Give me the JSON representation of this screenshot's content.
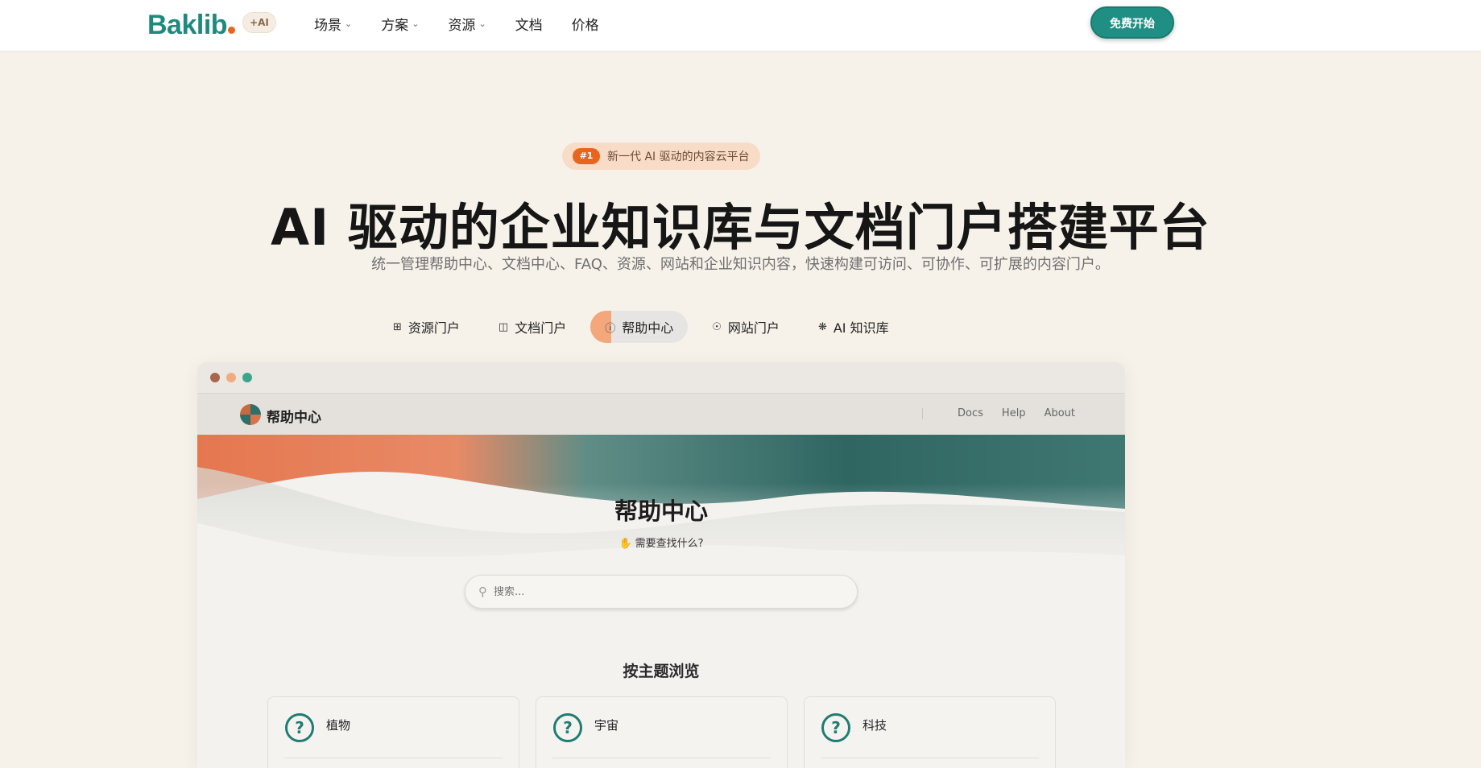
{
  "brand": {
    "name": "Baklib",
    "ai_badge": "+AI",
    "accent": "#1f8f84",
    "orange": "#e9651e"
  },
  "nav": {
    "items": [
      {
        "label": "场景",
        "dropdown": true
      },
      {
        "label": "方案",
        "dropdown": true
      },
      {
        "label": "资源",
        "dropdown": true
      },
      {
        "label": "文档",
        "dropdown": false
      },
      {
        "label": "价格",
        "dropdown": false
      }
    ],
    "cta": "免费开始"
  },
  "hero": {
    "announce_tag": "#1",
    "announce_text": "新一代 AI 驱动的内容云平台",
    "title": "AI 驱动的企业知识库与文档门户搭建平台",
    "subtitle": "统一管理帮助中心、文档中心、FAQ、资源、网站和企业知识内容，快速构建可访问、可协作、可扩展的内容门户。"
  },
  "tabs": [
    {
      "label": "资源门户",
      "icon": "resource-icon",
      "active": false
    },
    {
      "label": "文档门户",
      "icon": "document-icon",
      "active": false
    },
    {
      "label": "帮助中心",
      "icon": "help-icon",
      "active": true
    },
    {
      "label": "网站门户",
      "icon": "globe-icon",
      "active": false
    },
    {
      "label": "AI 知识库",
      "icon": "sparkle-icon",
      "active": false
    }
  ],
  "preview": {
    "site_name": "帮助中心",
    "links": [
      "Docs",
      "Help",
      "About"
    ],
    "title": "帮助中心",
    "subtitle": "需要查找什么?",
    "search_placeholder": "搜索...",
    "browse_title": "按主题浏览",
    "cards": [
      {
        "title": "植物"
      },
      {
        "title": "宇宙"
      },
      {
        "title": "科技"
      }
    ]
  }
}
